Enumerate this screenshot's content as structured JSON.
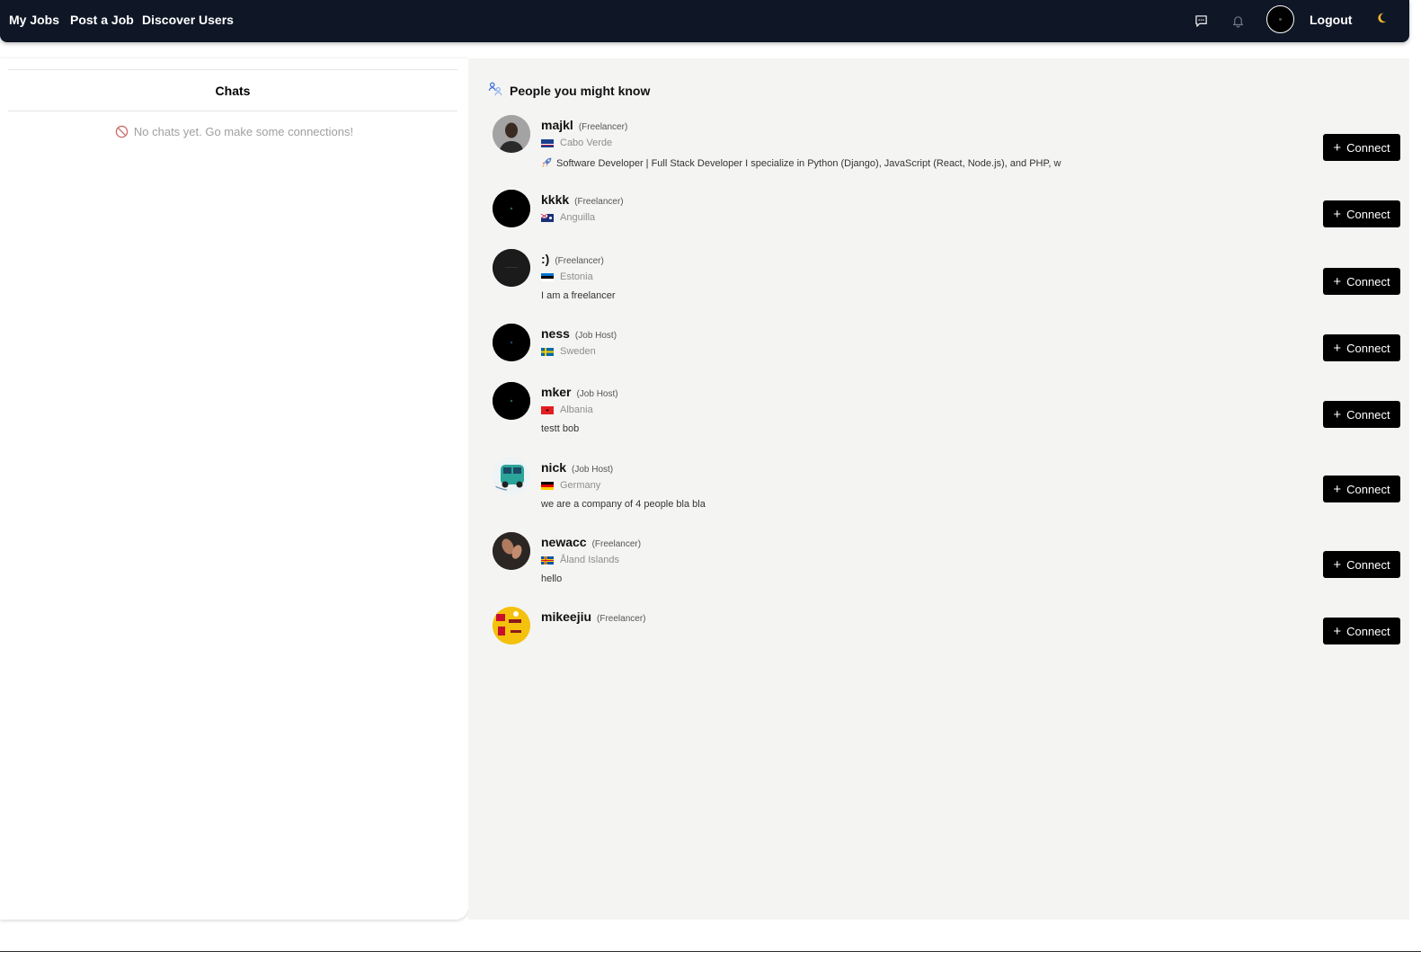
{
  "nav": {
    "links": [
      "My Jobs",
      "Post a Job",
      "Discover Users"
    ],
    "logout": "Logout",
    "icons": [
      "chat-icon",
      "bell-icon",
      "moon-icon"
    ]
  },
  "chats": {
    "title": "Chats",
    "empty_message": "No chats yet. Go make some connections!"
  },
  "people": {
    "title": "People you might know",
    "connect_label": "Connect",
    "users": [
      {
        "name": "majkl",
        "role": "(Freelancer)",
        "location": "Cabo Verde",
        "bio": "Software Developer | Full Stack Developer I specialize in Python (Django), JavaScript (React, Node.js), and PHP, w",
        "bio_icon": "rocket-icon"
      },
      {
        "name": "kkkk",
        "role": "(Freelancer)",
        "location": "Anguilla",
        "bio": ""
      },
      {
        "name": ":)",
        "role": "(Freelancer)",
        "location": "Estonia",
        "bio": "I am a freelancer"
      },
      {
        "name": "ness",
        "role": "(Job Host)",
        "location": "Sweden",
        "bio": ""
      },
      {
        "name": "mker",
        "role": "(Job Host)",
        "location": "Albania",
        "bio": "testt bob"
      },
      {
        "name": "nick",
        "role": "(Job Host)",
        "location": "Germany",
        "bio": "we are a company of 4 people bla bla"
      },
      {
        "name": "newacc",
        "role": "(Freelancer)",
        "location": "Åland Islands",
        "bio": "hello"
      },
      {
        "name": "mikeejiu",
        "role": "(Freelancer)",
        "location": "",
        "bio": ""
      }
    ]
  },
  "colors": {
    "navbar_bg": "#0f1726",
    "panel_bg": "#f4f4f3",
    "button_bg": "#000000",
    "moon": "#f5b82e"
  }
}
